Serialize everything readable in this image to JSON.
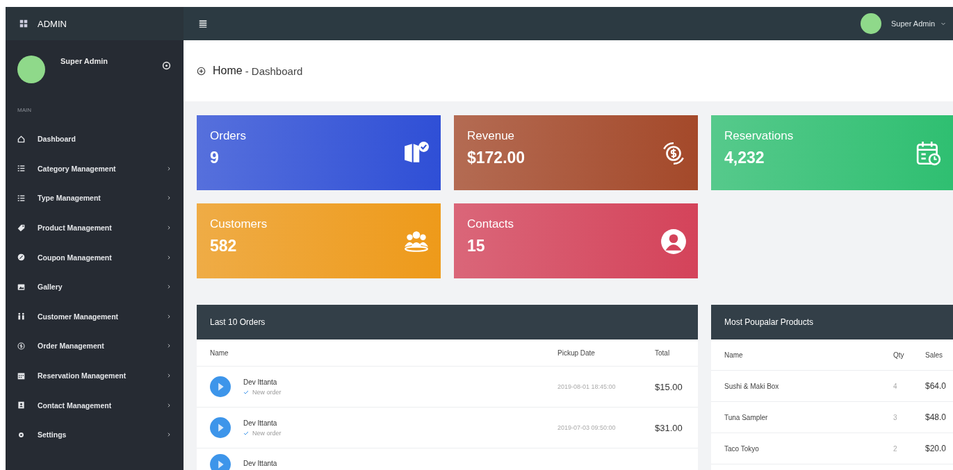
{
  "topbar": {
    "brand": "ADMIN",
    "user": "Super Admin"
  },
  "sidebar": {
    "user": "Super Admin",
    "section": "MAIN",
    "items": [
      {
        "label": "Dashboard",
        "arrow": false
      },
      {
        "label": "Category Management",
        "arrow": true
      },
      {
        "label": "Type Management",
        "arrow": true
      },
      {
        "label": "Product Management",
        "arrow": true
      },
      {
        "label": "Coupon Management",
        "arrow": true
      },
      {
        "label": "Gallery",
        "arrow": true
      },
      {
        "label": "Customer Management",
        "arrow": true
      },
      {
        "label": "Order Management",
        "arrow": true
      },
      {
        "label": "Reservation Management",
        "arrow": true
      },
      {
        "label": "Contact Management",
        "arrow": true
      },
      {
        "label": "Settings",
        "arrow": true
      }
    ]
  },
  "breadcrumb": {
    "current": "Home",
    "page": "- Dashboard"
  },
  "stats": [
    {
      "label": "Orders",
      "value": "9",
      "color": "#2f4fd6"
    },
    {
      "label": "Revenue",
      "value": "$172.00",
      "color": "#a4492a"
    },
    {
      "label": "Reservations",
      "value": "4,232",
      "color": "#2fbf71"
    },
    {
      "label": "Customers",
      "value": "582",
      "color": "#ee9a1a"
    },
    {
      "label": "Contacts",
      "value": "15",
      "color": "#d4435a"
    }
  ],
  "orders": {
    "title": "Last 10 Orders",
    "columns": [
      "Name",
      "Pickup Date",
      "Total"
    ],
    "rows": [
      {
        "name": "Dev Ittanta",
        "status": "New order",
        "date": "2019-08-01 18:45:00",
        "total": "$15.00"
      },
      {
        "name": "Dev Ittanta",
        "status": "New order",
        "date": "2019-07-03 09:50:00",
        "total": "$31.00"
      },
      {
        "name": "Dev Ittanta"
      }
    ]
  },
  "products": {
    "title": "Most Poupalar Products",
    "columns": [
      "Name",
      "Qty",
      "Sales"
    ],
    "rows": [
      {
        "name": "Sushi & Maki Box",
        "qty": "4",
        "sales": "$64.0"
      },
      {
        "name": "Tuna Sampler",
        "qty": "3",
        "sales": "$48.0"
      },
      {
        "name": "Taco Tokyo",
        "qty": "2",
        "sales": "$20.0"
      }
    ]
  }
}
